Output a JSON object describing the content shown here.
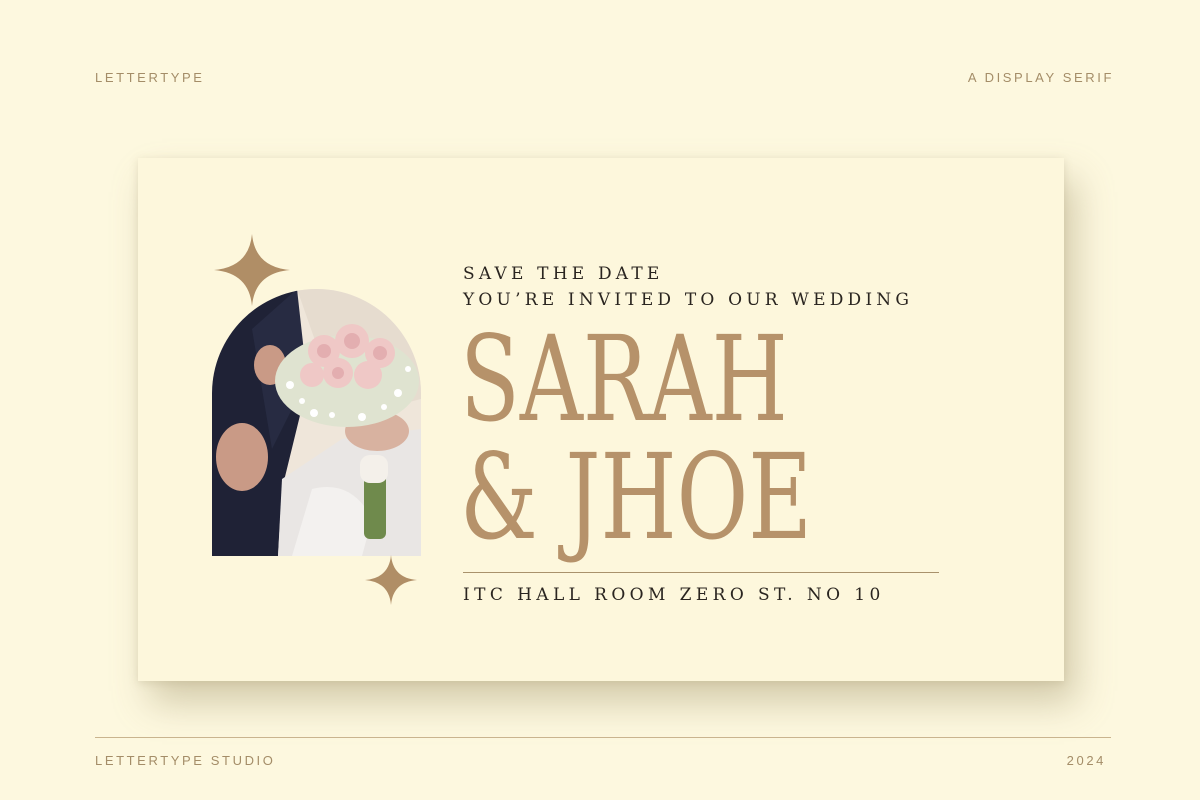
{
  "header": {
    "left": "LETTERTYPE",
    "right": "A DISPLAY SERIF"
  },
  "card": {
    "kicker_line1": "SAVE THE DATE",
    "kicker_line2": "YOU’RE INVITED TO OUR WEDDING",
    "names_line1": "SARAH",
    "names_line2": "& JHOE",
    "venue": "ITC HALL ROOM ZERO ST. NO 10"
  },
  "footer": {
    "left": "LETTERTYPE STUDIO",
    "right": "2024"
  },
  "colors": {
    "background": "#fdf8df",
    "accent": "#b6926a",
    "text_dark": "#2a2520",
    "label": "#a48d68"
  },
  "icons": [
    "sparkle-icon",
    "sparkle-icon",
    "sparkle-icon"
  ]
}
